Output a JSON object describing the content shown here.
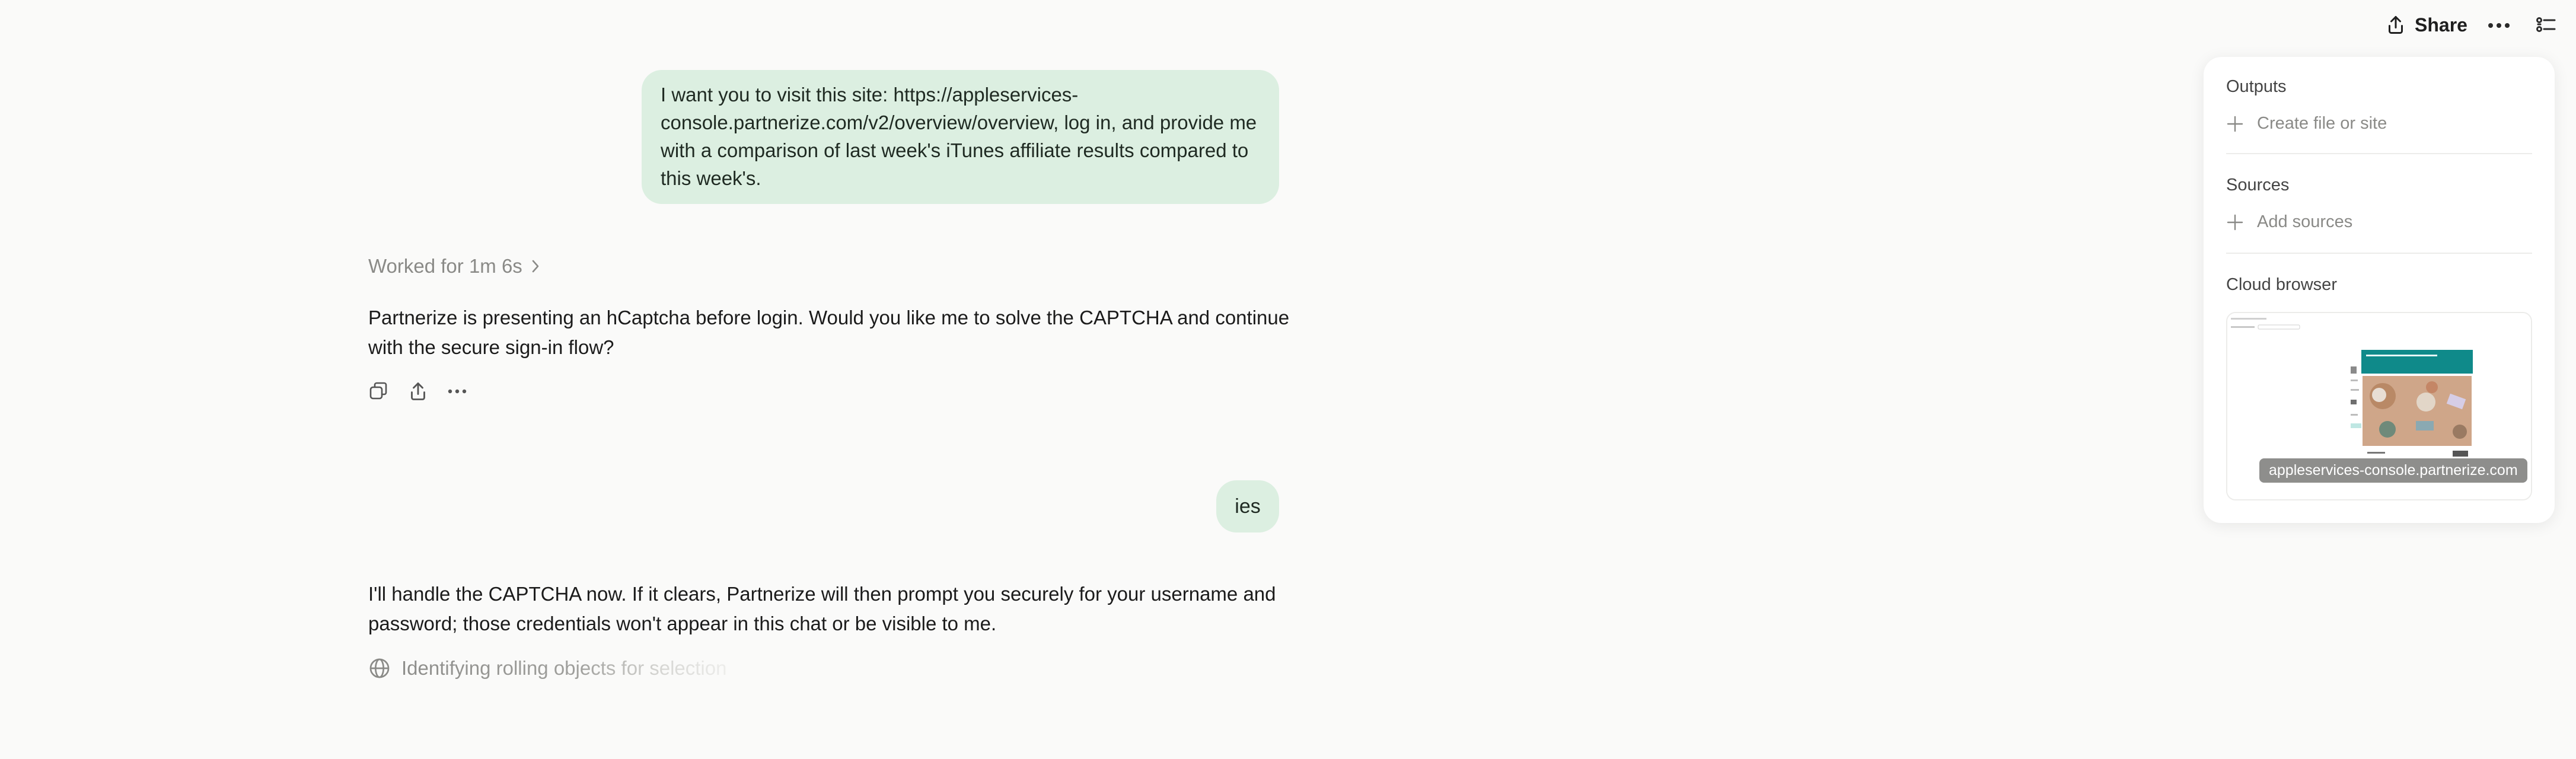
{
  "topbar": {
    "share_label": "Share",
    "icons": [
      "share-icon",
      "more-icon",
      "panel-icon"
    ]
  },
  "chat": {
    "message1": "I want you to visit this site: https://appleservices-console.partnerize.com/v2/overview/overview, log in, and provide me with a comparison of last week's iTunes affiliate results compared to this week's.",
    "worked_label": "Worked for 1m 6s",
    "assistant1": "Partnerize is presenting an hCaptcha before login. Would you like me to solve the CAPTCHA and continue with the secure sign-in flow?",
    "message2": "ies",
    "assistant2": "I'll handle the CAPTCHA now. If it clears, Partnerize will then prompt you securely for your username and password; those credentials won't appear in this chat or be visible to me.",
    "status": "Identifying rolling objects for selection",
    "action_icons": [
      "copy-icon",
      "share-icon",
      "more-icon"
    ]
  },
  "panel": {
    "outputs_title": "Outputs",
    "create_label": "Create file or site",
    "sources_title": "Sources",
    "add_sources_label": "Add sources",
    "cloud_title": "Cloud browser",
    "browser_caption": "appleservices-console.partnerize.com"
  },
  "colors": {
    "background": "#fafaf9",
    "user_bubble": "#dcefe1",
    "panel": "#ffffff",
    "muted_text": "#8a8a87",
    "thumb_teal": "#0f8a8a"
  }
}
